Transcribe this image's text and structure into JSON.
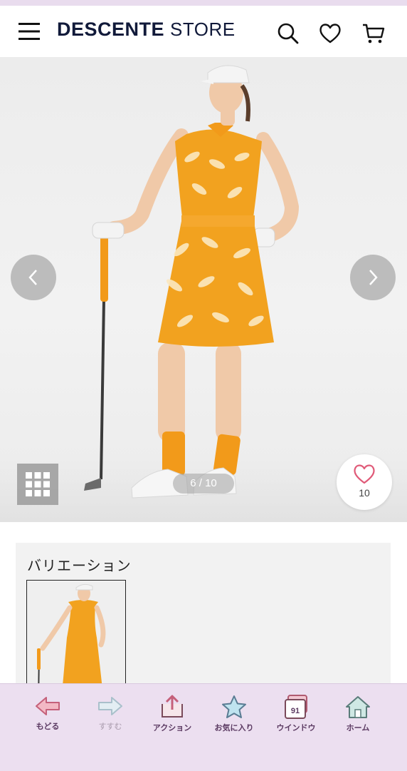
{
  "header": {
    "brand_name": "DESCENTE",
    "brand_suffix": "STORE",
    "icons": [
      "menu-icon",
      "search-icon",
      "heart-icon",
      "cart-icon"
    ]
  },
  "gallery": {
    "counter": "6 / 10",
    "favorite_count": "10",
    "icons": [
      "chevron-left-icon",
      "chevron-right-icon",
      "grid-icon",
      "heart-outline-icon"
    ]
  },
  "variation": {
    "title": "バリエーション"
  },
  "toolbar": {
    "items": [
      {
        "label": "もどる",
        "icon": "back-arrow-icon"
      },
      {
        "label": "すすむ",
        "icon": "forward-arrow-icon"
      },
      {
        "label": "アクション",
        "icon": "share-icon"
      },
      {
        "label": "お気に入り",
        "icon": "star-icon"
      },
      {
        "label": "ウインドウ",
        "icon": "windows-icon",
        "badge": "91"
      },
      {
        "label": "ホーム",
        "icon": "home-icon"
      }
    ]
  },
  "colors": {
    "brand": "#111a3a",
    "dress": "#f2a21f",
    "toolbar_bg": "#ecdff0",
    "heart": "#e05a78"
  }
}
